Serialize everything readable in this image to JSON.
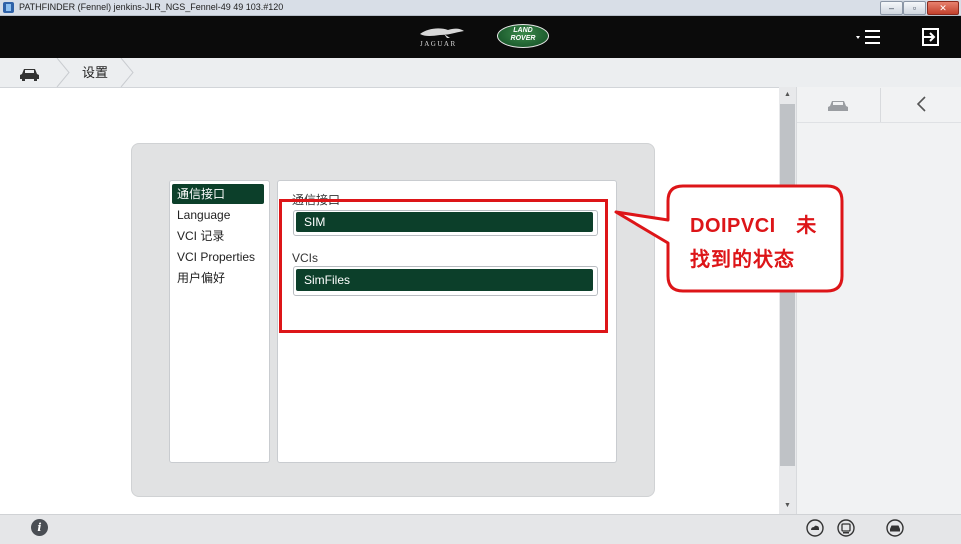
{
  "window": {
    "title": "PATHFINDER (Fennel) jenkins-JLR_NGS_Fennel-49 49 103.#120",
    "controls": {
      "minimize": "‒",
      "maximize": "▫",
      "close": "✕"
    }
  },
  "header": {
    "brand_jaguar": "JAGUAR",
    "brand_landrover_line1": "LAND",
    "brand_landrover_line2": "ROVER",
    "menu_icon": "menu-icon",
    "logout_icon": "logout-icon"
  },
  "breadcrumb": {
    "home_icon": "car-icon",
    "current": "设置"
  },
  "settings": {
    "nav_items": [
      {
        "label": "通信接口",
        "active": true
      },
      {
        "label": "Language",
        "active": false
      },
      {
        "label": "VCI 记录",
        "active": false
      },
      {
        "label": "VCI Properties",
        "active": false
      },
      {
        "label": "用户偏好",
        "active": false
      }
    ],
    "comm_interface": {
      "label": "通信接口",
      "value": "SIM"
    },
    "vcis": {
      "label": "VCIs",
      "value": "SimFiles"
    }
  },
  "annotation": {
    "callout_line1": "DOIPVCI　未",
    "callout_line2": "找到的状态",
    "color": "#dd1518"
  },
  "right_rail": {
    "car_icon": "car-icon",
    "back_icon": "chevron-left-icon"
  },
  "statusbar": {
    "info_label": "i",
    "icons": [
      "cloud-icon",
      "vci-icon",
      "car-icon"
    ]
  },
  "colors": {
    "accent_green": "#0c3f2a",
    "header_bg": "#0b0b0b",
    "annotation_red": "#dd1518"
  }
}
